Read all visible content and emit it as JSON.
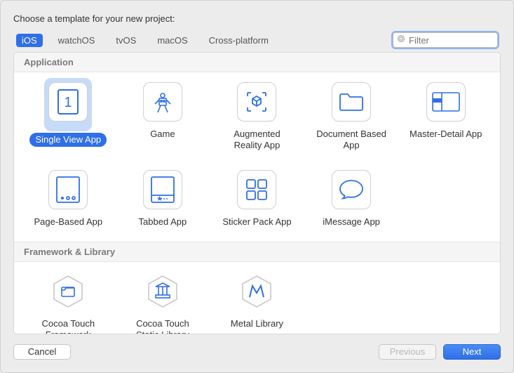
{
  "header": {
    "title": "Choose a template for your new project:"
  },
  "tabs": {
    "items": [
      {
        "label": "iOS",
        "active": true
      },
      {
        "label": "watchOS",
        "active": false
      },
      {
        "label": "tvOS",
        "active": false
      },
      {
        "label": "macOS",
        "active": false
      },
      {
        "label": "Cross-platform",
        "active": false
      }
    ]
  },
  "search": {
    "placeholder": "Filter",
    "value": ""
  },
  "sections": {
    "application": {
      "title": "Application",
      "templates": [
        {
          "label": "Single View App",
          "selected": true
        },
        {
          "label": "Game",
          "selected": false
        },
        {
          "label": "Augmented Reality App",
          "selected": false
        },
        {
          "label": "Document Based App",
          "selected": false
        },
        {
          "label": "Master-Detail App",
          "selected": false
        },
        {
          "label": "Page-Based App",
          "selected": false
        },
        {
          "label": "Tabbed App",
          "selected": false
        },
        {
          "label": "Sticker Pack App",
          "selected": false
        },
        {
          "label": "iMessage App",
          "selected": false
        }
      ]
    },
    "framework": {
      "title": "Framework & Library",
      "templates": [
        {
          "label": "Cocoa Touch Framework",
          "selected": false
        },
        {
          "label": "Cocoa Touch Static Library",
          "selected": false
        },
        {
          "label": "Metal Library",
          "selected": false
        }
      ]
    }
  },
  "footer": {
    "cancel": "Cancel",
    "previous": "Previous",
    "next": "Next"
  },
  "colors": {
    "accent": "#2f6fe8"
  }
}
